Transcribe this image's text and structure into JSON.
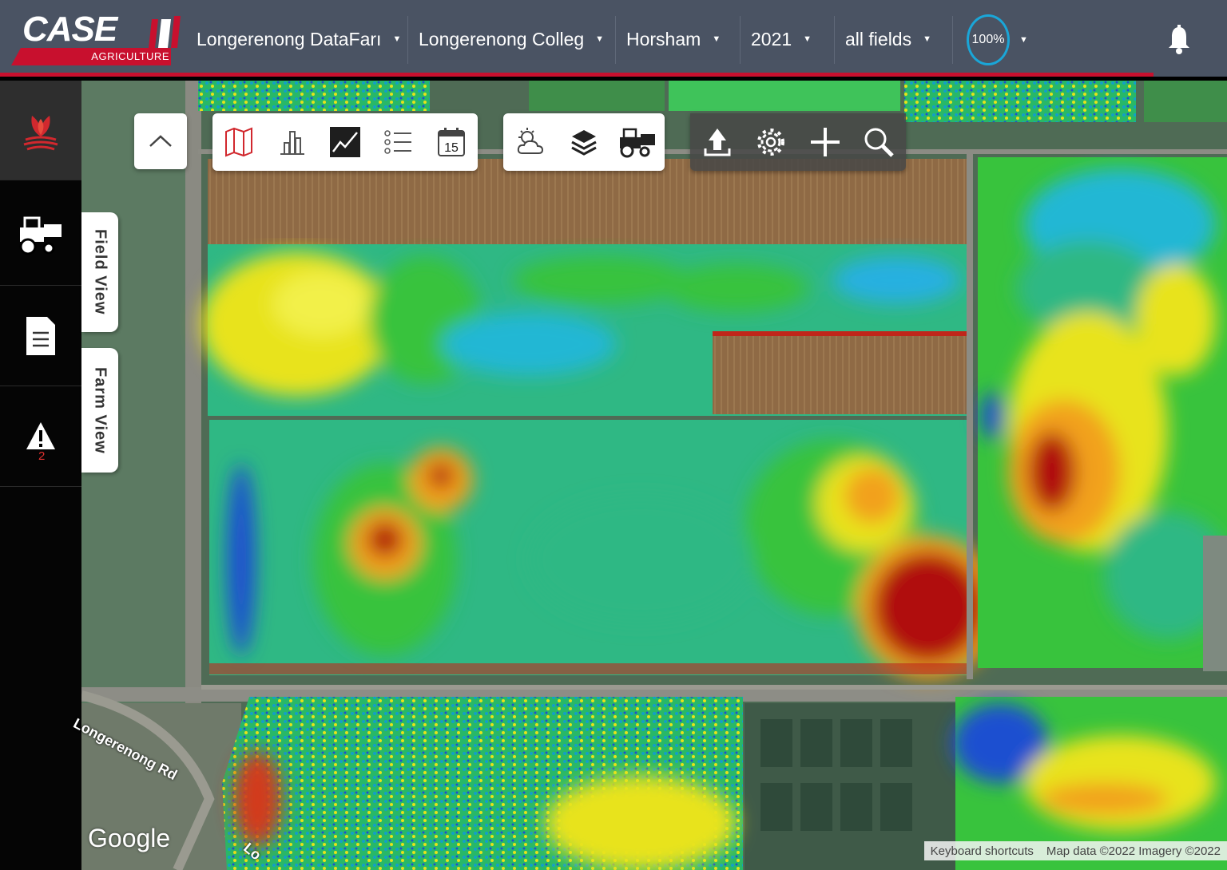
{
  "brand": {
    "name": "CASE",
    "sub": "AGRICULTURE",
    "color": "#c8102e"
  },
  "header": {
    "dropdowns": [
      {
        "label": "Longerenong DataFarı"
      },
      {
        "label": "Longerenong Colleg"
      },
      {
        "label": "Horsham"
      },
      {
        "label": "2021"
      },
      {
        "label": "all fields"
      }
    ],
    "zoom": "100%",
    "notifications_icon": "bell-icon"
  },
  "sidebar": {
    "items": [
      {
        "icon": "crop-leaf-icon",
        "active": true
      },
      {
        "icon": "harvester-icon"
      },
      {
        "icon": "document-icon"
      },
      {
        "icon": "warning-icon",
        "count": "2"
      }
    ]
  },
  "tabs": {
    "field_view": "Field View",
    "farm_view": "Farm View"
  },
  "toolbar": {
    "collapse_icon": "chevron-up-icon",
    "group1": [
      "map-icon",
      "bar-chart-icon",
      "line-chart-icon",
      "list-icon",
      "calendar-icon"
    ],
    "calendar_day": "15",
    "group2": [
      "weather-icon",
      "layers-icon",
      "harvester-icon"
    ],
    "group3": [
      "upload-icon",
      "gear-icon",
      "plus-icon",
      "search-icon"
    ]
  },
  "map": {
    "road_label": "Longerenong Rd",
    "road_label_2": "Lo",
    "google": "Google",
    "attribution": {
      "shortcuts": "Keyboard shortcuts",
      "data": "Map data ©2022 Imagery ©2022"
    }
  },
  "colors": {
    "topbar": "#4a5363",
    "accent_ring": "#1aa6d8",
    "sidebar": "#050505"
  }
}
